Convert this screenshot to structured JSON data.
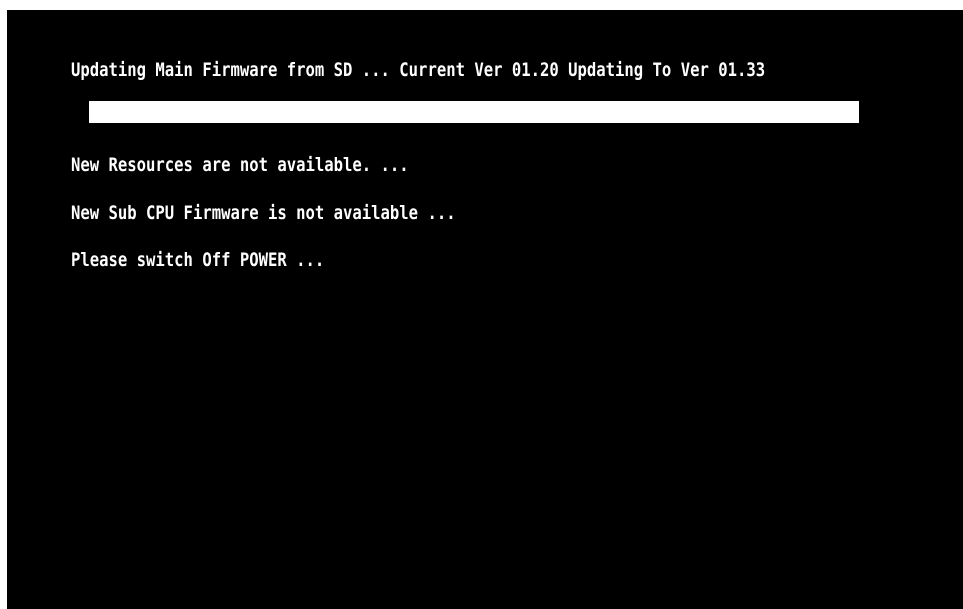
{
  "update_screen": {
    "status_line": "Updating Main Firmware from SD ... Current Ver 01.20 Updating To Ver 01.33",
    "progress": {
      "percent": 100,
      "color": "#ffffff"
    },
    "resources_message": "New Resources are not available. ...",
    "sub_cpu_message": "New Sub CPU Firmware is not available ...",
    "power_message": "Please switch Off POWER ..."
  },
  "colors": {
    "background": "#000000",
    "text": "#ffffff"
  }
}
